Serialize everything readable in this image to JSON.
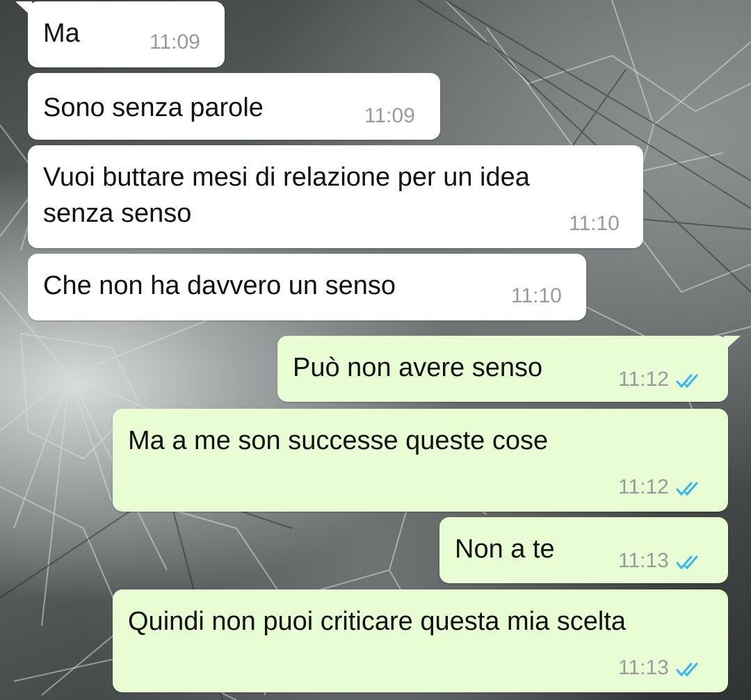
{
  "chat": {
    "messages": [
      {
        "direction": "incoming",
        "text": "Ma",
        "time": "11:09"
      },
      {
        "direction": "incoming",
        "text": "Sono senza parole",
        "time": "11:09"
      },
      {
        "direction": "incoming",
        "text_lines": [
          "Vuoi buttare mesi di relazione per un idea",
          "senza senso"
        ],
        "time": "11:10"
      },
      {
        "direction": "incoming",
        "text": "Che non ha davvero un senso",
        "time": "11:10"
      },
      {
        "direction": "outgoing",
        "text": "Può non avere senso",
        "time": "11:12",
        "status_icon": "double-check-read-icon"
      },
      {
        "direction": "outgoing",
        "text": "Ma a me son successe queste cose",
        "time": "11:12",
        "status_icon": "double-check-read-icon"
      },
      {
        "direction": "outgoing",
        "text": "Non a te",
        "time": "11:13",
        "status_icon": "double-check-read-icon"
      },
      {
        "direction": "outgoing",
        "text": "Quindi non puoi criticare questa mia scelta",
        "time": "11:13",
        "status_icon": "double-check-read-icon"
      }
    ]
  },
  "colors": {
    "incoming_bubble": "#ffffff",
    "outgoing_bubble": "#e8fdd4",
    "timestamp": "#9a9a9a",
    "read_check": "#34b7f1",
    "wallpaper": "#5a5d5e"
  }
}
